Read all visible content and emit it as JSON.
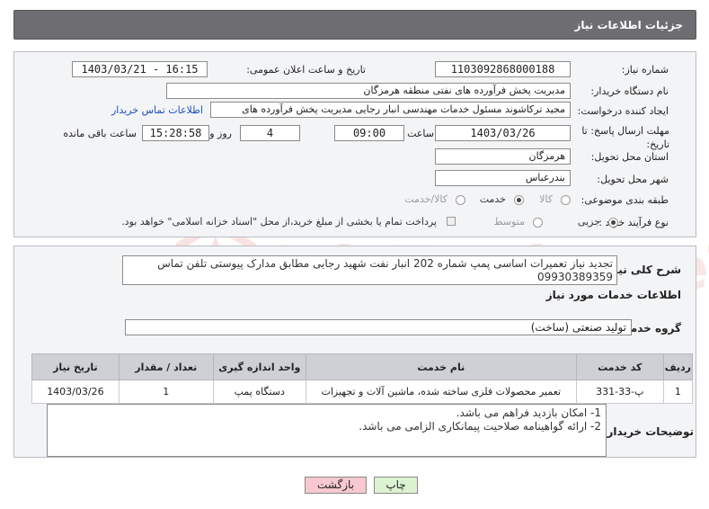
{
  "header": {
    "title": "جزئیات اطلاعات نیاز"
  },
  "form": {
    "need_number_label": "شماره نیاز:",
    "need_number": "1103092868000188",
    "announce_label": "تاریخ و ساعت اعلان عمومی:",
    "announce_value": "1403/03/21 - 16:15",
    "buyer_label": "نام دستگاه خریدار:",
    "buyer_value": "مدیریت پخش فرآورده های نفتی منطقه هرمزگان",
    "creator_label": "ایجاد کننده درخواست:",
    "creator_value": "مجید ترکاشوند مسئول خدمات مهندسی انبار رجایی مدیریت پخش فرآورده های",
    "contact_link": "اطلاعات تماس خریدار",
    "deadline_label": "مهلت ارسال پاسخ: تا تاریخ:",
    "deadline_date": "1403/03/26",
    "time_label": "ساعت",
    "deadline_time": "09:00",
    "days_value": "4",
    "days_label": "روز و",
    "remaining_time": "15:28:58",
    "remaining_label": "ساعت باقی مانده",
    "province_label": "استان محل تحویل:",
    "province_value": "هرمزگان",
    "city_label": "شهر محل تحویل:",
    "city_value": "بندرعباس",
    "category_label": "طبقه بندی موضوعی:",
    "category_options": [
      "کالا",
      "خدمت",
      "کالا/خدمت"
    ],
    "category_selected": "خدمت",
    "process_label": "نوع فرآیند خرید :",
    "process_options": [
      "جزیی",
      "متوسط"
    ],
    "process_selected": "جزیی",
    "treasury_note": "پرداخت تمام یا بخشی از مبلغ خرید،از محل \"اسناد خزانه اسلامی\" خواهد بود."
  },
  "summary": {
    "label": "شرح کلی نیاز:",
    "value": "تجدید نیاز تعمیرات اساسی پمپ شماره 202 انبار نفت شهید رجایی مطابق مدارک پیوستی تلفن تماس 09930389359"
  },
  "services": {
    "section_title": "اطلاعات خدمات مورد نیاز",
    "group_label": "گروه خدمت:",
    "group_value": "تولید صنعتی (ساخت)",
    "table": {
      "headers": [
        "ردیف",
        "کد خدمت",
        "نام خدمت",
        "واحد اندازه گیری",
        "تعداد / مقدار",
        "تاریخ نیاز"
      ],
      "rows": [
        [
          "1",
          "پ-33-331",
          "تعمیر محصولات فلزی ساخته شده، ماشین آلات و تجهیزات",
          "دستگاه پمپ",
          "1",
          "1403/03/26"
        ]
      ]
    }
  },
  "notes": {
    "label": "توضیحات خریدار:",
    "line1": "1- امکان بازدید فراهم می باشد.",
    "line2": "2- ارائه گواهینامه صلاحیت پیمانکاری الزامی می باشد."
  },
  "buttons": {
    "print": "چاپ",
    "back": "بازگشت"
  },
  "watermark": "AriaTender.neT",
  "colors": {
    "header_bg": "#6e6e72",
    "link": "#1a4fbf",
    "back_button": "#f7c8cf",
    "print_button": "#dcf3d2"
  }
}
